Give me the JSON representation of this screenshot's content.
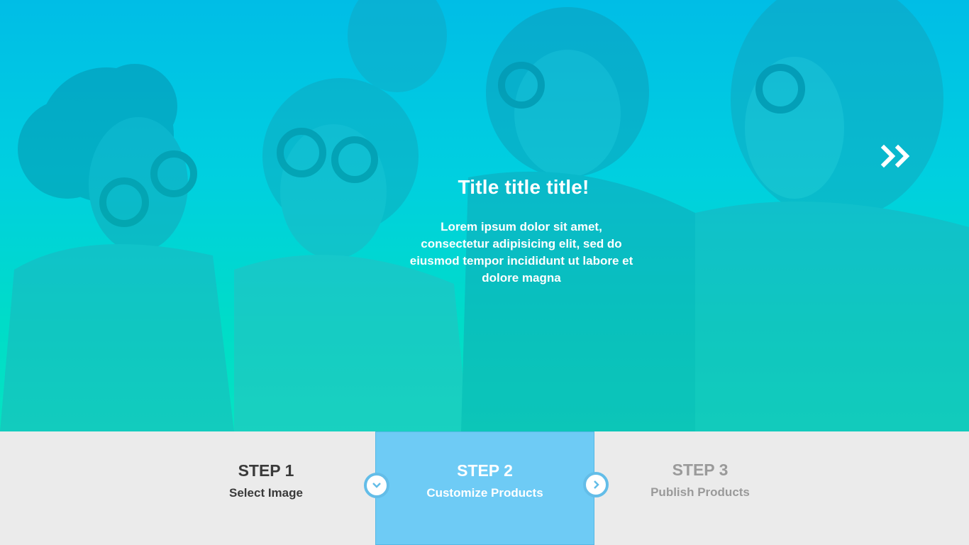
{
  "hero": {
    "title": "Title title title!",
    "body": "Lorem ipsum dolor sit amet, consectetur adipisicing elit, sed do eiusmod tempor incididunt ut labore et dolore magna",
    "next_icon": "double-chevron-right-icon"
  },
  "steps": [
    {
      "number": "STEP 1",
      "label": "Select Image",
      "state": "completed"
    },
    {
      "number": "STEP 2",
      "label": "Customize Products",
      "state": "active"
    },
    {
      "number": "STEP 3",
      "label": "Publish Products",
      "state": "inactive"
    }
  ],
  "connectors": [
    {
      "icon": "chevron-down-icon"
    },
    {
      "icon": "chevron-right-icon"
    }
  ],
  "colors": {
    "gradient_top": "#00bde6",
    "gradient_bottom": "#04e4c2",
    "active_step": "#6ecbf5",
    "footer_bg": "#ebebeb"
  }
}
